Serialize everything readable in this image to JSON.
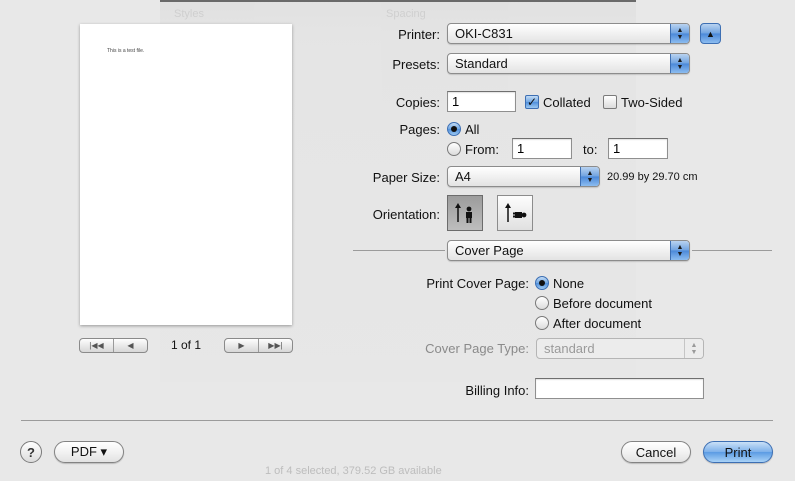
{
  "background_window": {
    "toolbar_items": [
      "Styles",
      "Spacing"
    ],
    "status_text": "1 of 4 selected, 379.52 GB available"
  },
  "preview": {
    "page_text": "This is a test file.",
    "page_count": "1 of 1"
  },
  "printer": {
    "label": "Printer:",
    "value": "OKI-C831"
  },
  "presets": {
    "label": "Presets:",
    "value": "Standard"
  },
  "copies": {
    "label": "Copies:",
    "value": "1"
  },
  "collated": {
    "label": "Collated",
    "checked": true,
    "mark": "✓"
  },
  "two_sided": {
    "label": "Two-Sided",
    "checked": false
  },
  "pages": {
    "label": "Pages:",
    "all_label": "All",
    "from_label": "From:",
    "from_value": "1",
    "to_label": "to:",
    "to_value": "1"
  },
  "paper_size": {
    "label": "Paper Size:",
    "value": "A4",
    "dimensions": "20.99 by 29.70 cm"
  },
  "orientation": {
    "label": "Orientation:"
  },
  "section_popup": {
    "value": "Cover Page"
  },
  "print_cover_page": {
    "label": "Print Cover Page:",
    "options": [
      "None",
      "Before document",
      "After document"
    ],
    "selected": "None"
  },
  "cover_page_type": {
    "label": "Cover Page Type:",
    "value": "standard"
  },
  "billing_info": {
    "label": "Billing Info:",
    "value": ""
  },
  "footer": {
    "help_label": "?",
    "pdf_label": "PDF ▾",
    "cancel_label": "Cancel",
    "print_label": "Print"
  },
  "colors": {
    "accent": "#5b9be3",
    "sheet_bg": "#e8e8e8"
  }
}
